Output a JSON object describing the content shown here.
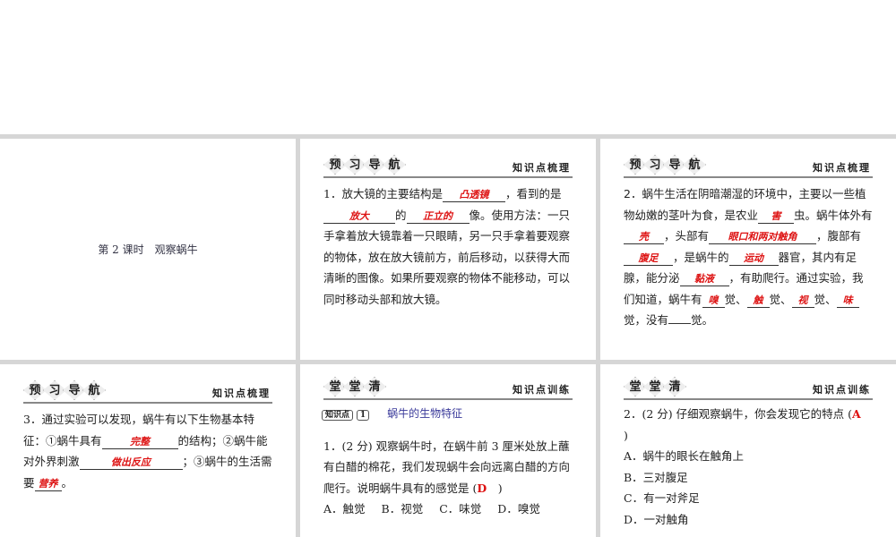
{
  "cover": {
    "title": "第 2 课时　观察蜗牛"
  },
  "preview": {
    "badge": [
      "预",
      "习",
      "导",
      "航"
    ],
    "right": "知识点梳理"
  },
  "class": {
    "badge": [
      "堂",
      "堂",
      "清"
    ],
    "right": "知识点训练"
  },
  "q1": {
    "a": "1．放大镜的主要结构是",
    "b1": "凸透镜",
    "c": "，看到的是",
    "b2": "放大",
    "d": "的",
    "b3": "正立的",
    "e": "像。使用方法：一只手拿着放大镜靠着一只眼睛，另一只手拿着要观察的物体，放在放大镜前方，前后移动，以获得大而清晰的图像。如果所要观察的物体不能移动，可以同时移动头部和放大镜。"
  },
  "q2": {
    "a": "2．蜗牛生活在阴暗潮湿的环境中",
    "b": "，主要以一些植物幼嫩的茎叶为食，是农业",
    "b1": "害",
    "c": "虫。蜗牛体外有",
    "b2": "壳",
    "d": "，头部有",
    "b3": "眼口和两对触角",
    "e": "，腹部有",
    "b4": "腹足",
    "f": "，是蜗牛的",
    "b5": "运动",
    "g": "器官，其内有足腺，能分泌",
    "b6": "黏液",
    "h": "，有助爬行。通过实验，我们知道，蜗牛有",
    "b7": "嗅",
    "i": "觉、",
    "b8": "触",
    "j": "觉、",
    "b9": "视",
    "k": "觉、",
    "b10": "味",
    "l": "觉，没有",
    "m": "觉。"
  },
  "q3": {
    "a": "3．通过实验可以发现，蜗牛有以下生物基本特征：①蜗牛具有",
    "b1": "完整",
    "c": "的结构；②蜗牛能对外界刺激",
    "b2": "做出反应",
    "d": "；③蜗牛的生活需要",
    "b3": "营养",
    "e": "。"
  },
  "k1": {
    "tag": "知识点",
    "num": "1",
    "topic": "蜗牛的生物特征"
  },
  "e1": {
    "q": "1．(2 分) 观察蜗牛时，在蜗牛前 3 厘米处放上蘸有白醋的棉花，我们发现蜗牛会向远离白醋的方向爬行。说明蜗牛具有的感觉是 (",
    "ans": "D",
    "close": ")",
    "opts": [
      "A．触觉",
      "B．视觉",
      "C．味觉",
      "D．嗅觉"
    ]
  },
  "e2": {
    "q": "2．(2 分) 仔细观察蜗牛，你会发现它的特点 (",
    "ans": "A",
    "close": ")",
    "opts": [
      "A．蜗牛的眼长在触角上",
      "B．三对腹足",
      "C．有一对斧足",
      "D．一对触角"
    ]
  }
}
